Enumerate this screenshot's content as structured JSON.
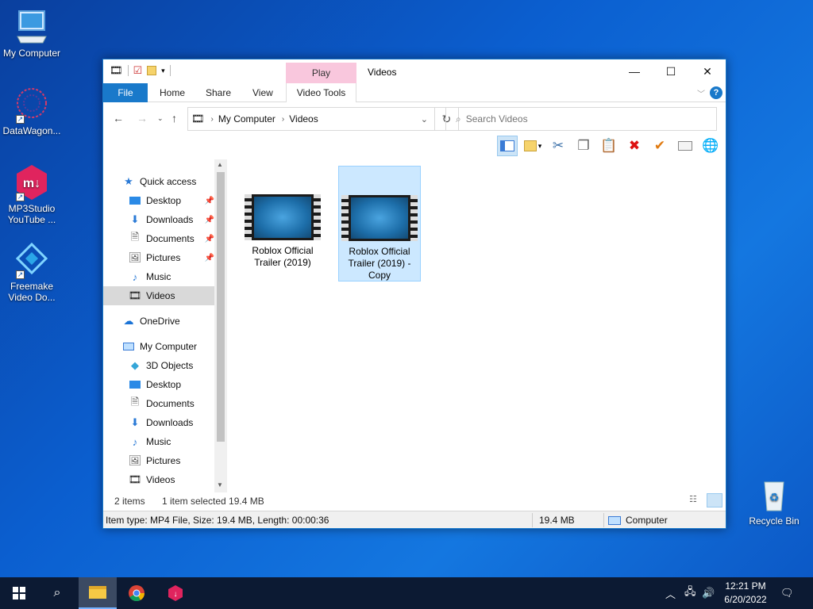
{
  "desktop": {
    "icons": [
      {
        "label": "My Computer"
      },
      {
        "label": "DataWagon..."
      },
      {
        "label": "MP3Studio YouTube ..."
      },
      {
        "label": "Freemake Video Do..."
      },
      {
        "label": "Recycle Bin"
      }
    ]
  },
  "window": {
    "title": "Videos",
    "contextual_tab_group": "Play",
    "tabs": [
      "File",
      "Home",
      "Share",
      "View",
      "Video Tools"
    ],
    "address": {
      "segments": [
        "My Computer",
        "Videos"
      ]
    },
    "search_placeholder": "Search Videos",
    "nav": {
      "quick_access": "Quick access",
      "items": [
        {
          "label": "Desktop"
        },
        {
          "label": "Downloads"
        },
        {
          "label": "Documents"
        },
        {
          "label": "Pictures"
        },
        {
          "label": "Music"
        },
        {
          "label": "Videos"
        }
      ],
      "onedrive": "OneDrive",
      "my_computer": "My Computer",
      "pc_items": [
        {
          "label": "3D Objects"
        },
        {
          "label": "Desktop"
        },
        {
          "label": "Documents"
        },
        {
          "label": "Downloads"
        },
        {
          "label": "Music"
        },
        {
          "label": "Pictures"
        },
        {
          "label": "Videos"
        }
      ]
    },
    "files": [
      {
        "name": "Roblox   Official Trailer (2019)"
      },
      {
        "name": "Roblox   Official Trailer (2019) - Copy"
      }
    ],
    "status": {
      "items_count": "2 items",
      "selection": "1 item selected  19.4 MB"
    },
    "statusbar": {
      "details": "Item type: MP4 File, Size: 19.4 MB, Length: 00:00:36",
      "size": "19.4 MB",
      "location": "Computer"
    }
  },
  "taskbar": {
    "time": "12:21 PM",
    "date": "6/20/2022"
  }
}
